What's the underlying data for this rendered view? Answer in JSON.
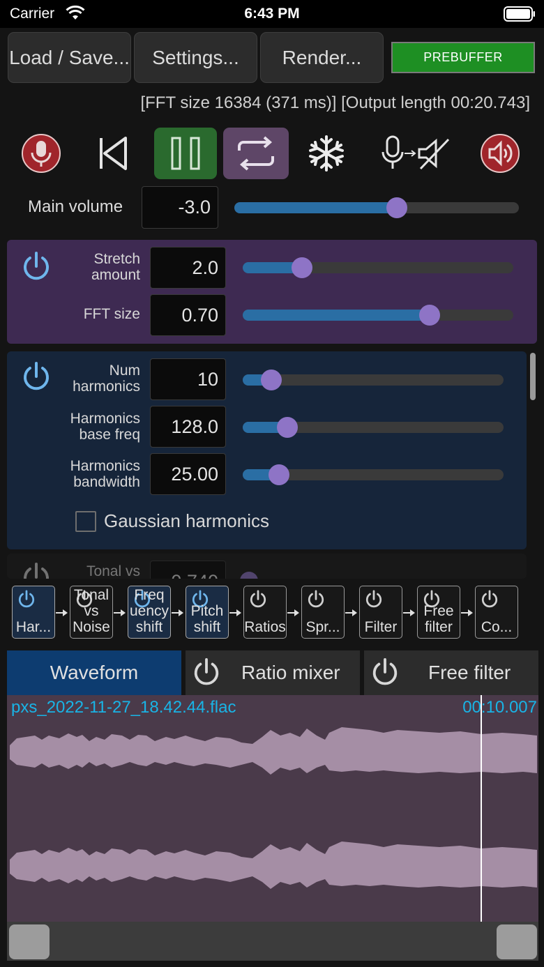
{
  "status": {
    "carrier": "Carrier",
    "time": "6:43 PM"
  },
  "toolbar": {
    "load_save": "Load / Save...",
    "settings": "Settings...",
    "render": "Render...",
    "prebuffer": "PREBUFFER"
  },
  "info": "[FFT size 16384 (371 ms)] [Output length 00:20.743]",
  "main_volume": {
    "label": "Main volume",
    "value": "-3.0",
    "level": 0.57
  },
  "stretch_panel": {
    "stretch_label": "Stretch amount",
    "stretch_value": "2.0",
    "stretch_level": 0.22,
    "fft_label": "FFT size",
    "fft_value": "0.70",
    "fft_level": 0.69
  },
  "harmonics_panel": {
    "num_label": "Num harmonics",
    "num_value": "10",
    "num_level": 0.11,
    "base_label": "Harmonics base freq",
    "base_value": "128.0",
    "base_level": 0.17,
    "bw_label": "Harmonics bandwidth",
    "bw_value": "25.00",
    "bw_level": 0.14,
    "gaussian_label": "Gaussian harmonics",
    "gaussian_checked": false
  },
  "tonal_panel": {
    "label": "Tonal vs",
    "value": "0.740"
  },
  "chain": [
    {
      "label": "Har...",
      "active": true
    },
    {
      "label": "Tonal vs Noise",
      "active": false
    },
    {
      "label": "Freq uency shift",
      "active": true
    },
    {
      "label": "Pitch shift",
      "active": true
    },
    {
      "label": "Ratios",
      "active": false
    },
    {
      "label": "Spr...",
      "active": false
    },
    {
      "label": "Filter",
      "active": false
    },
    {
      "label": "Free filter",
      "active": false
    },
    {
      "label": "Co...",
      "active": false
    }
  ],
  "tabs": {
    "waveform": "Waveform",
    "ratio": "Ratio mixer",
    "free": "Free filter"
  },
  "waveform": {
    "filename": "pxs_2022-11-27_18.42.44.flac",
    "time": "00:10.007"
  },
  "colors": {
    "accent_blue": "#2a6ea4",
    "knob": "#8e74c6",
    "prebuffer_green": "#1e8f23",
    "wave_text": "#19b4e6"
  }
}
